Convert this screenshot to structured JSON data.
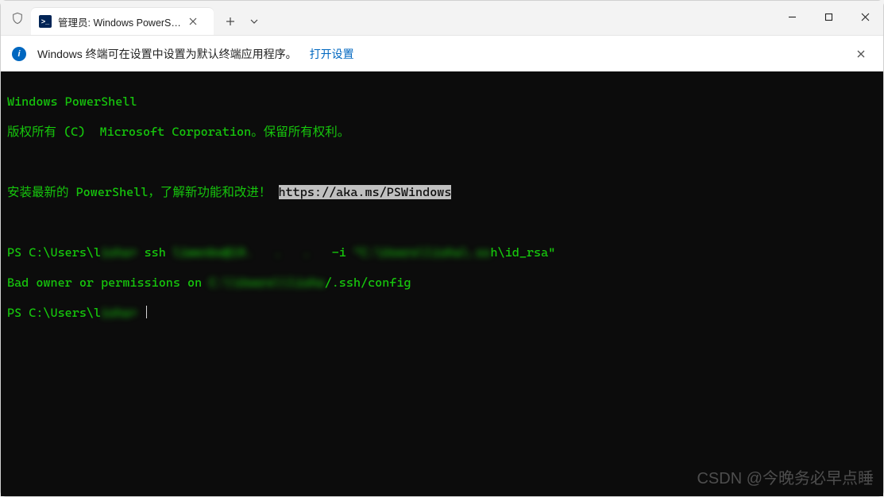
{
  "tab": {
    "title": "管理员: Windows PowerShell",
    "icon_label": ">_"
  },
  "infobar": {
    "message": "Windows 终端可在设置中设置为默认终端应用程序。",
    "link_label": "打开设置"
  },
  "terminal": {
    "line1": "Windows PowerShell",
    "line2": "版权所有 (C)  Microsoft Corporation。保留所有权利。",
    "line3_pre": "安装最新的 PowerShell，了解新功能和改进！",
    "line3_url": "https://aka.ms/PSWindows",
    "line4_prompt_prefix": "PS C:\\Users\\l",
    "line4_prompt_blurred": "isha>",
    "line4_cmd_1": " ssh ",
    "line4_cmd_blur1": "liwenbo@19.   .   . ",
    "line4_cmd_2": "  -i ",
    "line4_cmd_blur2": "\"C:\\Users\\lisha\\.ss",
    "line4_cmd_3": "h\\id_rsa\"",
    "line5_prefix": "Bad owner or permissions on ",
    "line5_blur": "C:\\\\Users\\\\lisha",
    "line5_suffix": "/.ssh/config",
    "line6_prompt_prefix": "PS C:\\Users\\l",
    "line6_prompt_blurred": "isha>"
  },
  "watermark": "CSDN @今晚务必早点睡"
}
